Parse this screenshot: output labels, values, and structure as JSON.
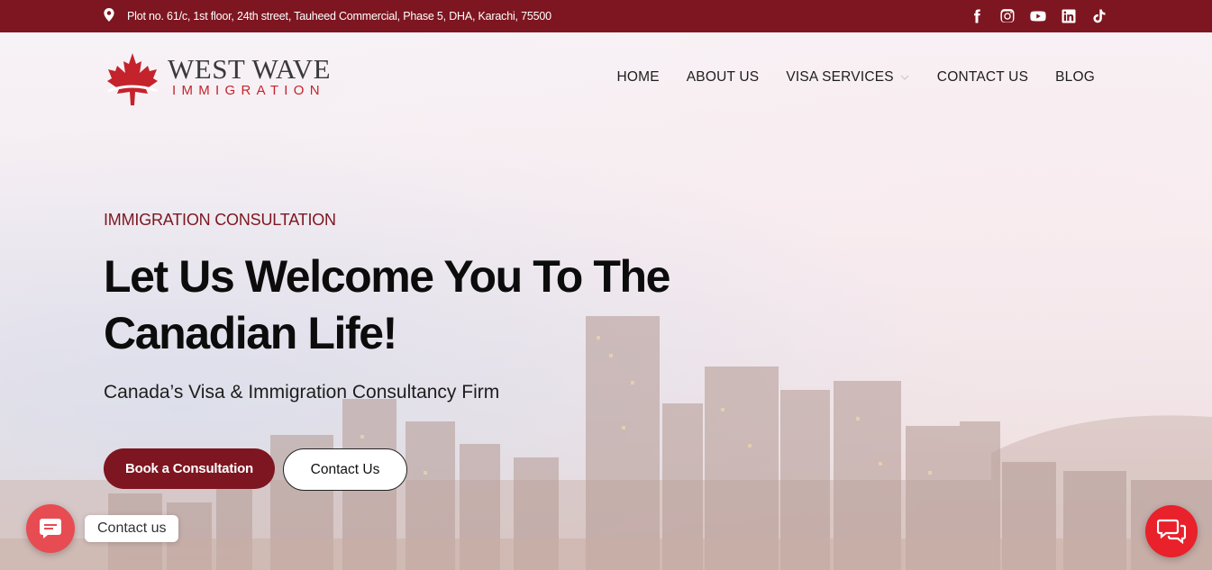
{
  "topbar": {
    "address": "Plot no. 61/c, 1st floor, 24th street, Tauheed Commercial, Phase 5, DHA, Karachi, 75500",
    "socials": [
      "facebook",
      "instagram",
      "youtube",
      "linkedin",
      "tiktok"
    ]
  },
  "logo": {
    "line1": "WEST WAVE",
    "line2": "IMMIGRATION"
  },
  "nav": {
    "items": [
      "HOME",
      "ABOUT US",
      "VISA SERVICES",
      "CONTACT US",
      "BLOG"
    ]
  },
  "hero": {
    "eyebrow": "IMMIGRATION CONSULTATION",
    "headline_line1": "Let Us Welcome You To The",
    "headline_line2": "Canadian Life!",
    "subheading": "Canada’s Visa & Immigration Consultancy Firm",
    "primary_button": "Book a Consultation",
    "secondary_button": "Contact Us"
  },
  "widgets": {
    "contact_label": "Contact us"
  },
  "colors": {
    "brand": "#7d1620",
    "accent_red": "#c4232c",
    "chat_red": "#e8212b",
    "contact_red": "#e74c52"
  },
  "icons": {
    "address": "map-pin-icon",
    "nav_dropdown": "chevron-down-icon",
    "contact": "message-icon",
    "chat": "chat-bubbles-icon"
  }
}
